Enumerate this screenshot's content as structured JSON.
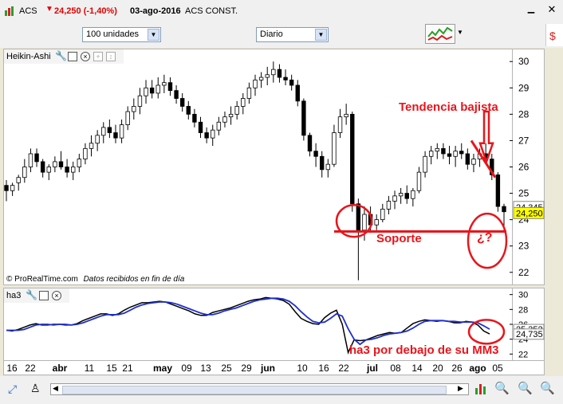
{
  "title": {
    "symbol": "ACS",
    "price": "24,250 (-1,40%)",
    "date": "03-ago-2016",
    "name": "ACS CONST."
  },
  "toolbar": {
    "units": "100 unidades",
    "period": "Diario"
  },
  "price_panel": {
    "indicator_label": "Heikin-Ashi",
    "axis_ticks": [
      "30",
      "29",
      "28",
      "27",
      "26",
      "25",
      "24",
      "23",
      "22"
    ],
    "price_tag_1": "24,345",
    "price_tag_2": "24,250",
    "watermark_brand": "© ProRealTime.com",
    "watermark_note": "Datos recibidos en fin de día",
    "annotations": {
      "trend": "Tendencia bajista",
      "support": "Soporte",
      "question": "¿?"
    }
  },
  "ind_panel": {
    "label": "ha3",
    "axis_ticks": [
      "30",
      "28",
      "26",
      "24",
      "22"
    ],
    "value_1": "25,352",
    "value_2": "24,735",
    "annotation": "ha3 por debajo de su MM3"
  },
  "date_axis": [
    "16",
    "22",
    "abr",
    "11",
    "15",
    "21",
    "may",
    "09",
    "13",
    "25",
    "29",
    "jun",
    "10",
    "16",
    "22",
    "jul",
    "08",
    "14",
    "20",
    "26",
    "ago",
    "05"
  ],
  "colors": {
    "up": "#ffffff",
    "down": "#000000",
    "annotation": "#e8151b",
    "ma": "#1f2fc9",
    "tag_yellow": "#ffff00"
  },
  "chart_data": [
    {
      "type": "candlestick",
      "title": "",
      "ylim": [
        21.6,
        30.4
      ],
      "candles": [
        [
          25.3,
          25.5,
          24.7,
          25.1
        ],
        [
          25.1,
          25.4,
          24.9,
          25.3
        ],
        [
          25.4,
          25.7,
          25.1,
          25.6
        ],
        [
          25.6,
          26.3,
          25.4,
          26.0
        ],
        [
          26.0,
          26.7,
          25.8,
          26.5
        ],
        [
          26.5,
          26.7,
          26.0,
          26.2
        ],
        [
          26.2,
          26.3,
          25.6,
          25.8
        ],
        [
          25.8,
          26.1,
          25.5,
          26.0
        ],
        [
          26.0,
          26.4,
          25.8,
          26.2
        ],
        [
          26.2,
          26.6,
          25.9,
          26.0
        ],
        [
          26.0,
          26.3,
          25.6,
          25.8
        ],
        [
          25.8,
          26.2,
          25.5,
          26.0
        ],
        [
          26.0,
          26.5,
          25.8,
          26.3
        ],
        [
          26.3,
          26.9,
          26.1,
          26.7
        ],
        [
          26.7,
          27.2,
          26.4,
          26.9
        ],
        [
          26.9,
          27.4,
          26.6,
          27.2
        ],
        [
          27.2,
          27.7,
          26.9,
          27.5
        ],
        [
          27.5,
          27.8,
          27.1,
          27.3
        ],
        [
          27.3,
          27.6,
          26.9,
          27.1
        ],
        [
          27.1,
          27.8,
          26.9,
          27.6
        ],
        [
          27.6,
          28.3,
          27.4,
          28.1
        ],
        [
          28.1,
          28.6,
          27.8,
          28.3
        ],
        [
          28.3,
          29.0,
          28.0,
          28.7
        ],
        [
          28.7,
          29.3,
          28.4,
          29.0
        ],
        [
          29.0,
          29.3,
          28.6,
          28.8
        ],
        [
          28.8,
          29.4,
          28.6,
          29.1
        ],
        [
          29.1,
          29.5,
          28.8,
          29.2
        ],
        [
          29.2,
          29.4,
          28.7,
          28.9
        ],
        [
          28.9,
          29.1,
          28.4,
          28.6
        ],
        [
          28.6,
          28.8,
          28.1,
          28.3
        ],
        [
          28.3,
          28.5,
          27.8,
          28.0
        ],
        [
          28.0,
          28.2,
          27.5,
          27.7
        ],
        [
          27.7,
          27.9,
          27.1,
          27.3
        ],
        [
          27.3,
          27.5,
          26.9,
          27.1
        ],
        [
          27.1,
          27.6,
          26.8,
          27.4
        ],
        [
          27.4,
          27.9,
          27.2,
          27.7
        ],
        [
          27.7,
          28.1,
          27.5,
          27.9
        ],
        [
          27.9,
          28.3,
          27.6,
          28.0
        ],
        [
          28.0,
          28.5,
          27.8,
          28.3
        ],
        [
          28.3,
          28.8,
          28.0,
          28.6
        ],
        [
          28.6,
          29.2,
          28.4,
          29.0
        ],
        [
          29.0,
          29.5,
          28.7,
          29.3
        ],
        [
          29.3,
          29.6,
          29.0,
          29.4
        ],
        [
          29.4,
          29.8,
          29.1,
          29.5
        ],
        [
          29.5,
          30.0,
          29.2,
          29.7
        ],
        [
          29.7,
          29.9,
          29.2,
          29.4
        ],
        [
          29.4,
          29.7,
          29.1,
          29.3
        ],
        [
          29.3,
          29.5,
          28.9,
          29.1
        ],
        [
          29.1,
          29.3,
          28.3,
          28.5
        ],
        [
          28.5,
          28.6,
          27.0,
          27.2
        ],
        [
          27.2,
          27.3,
          26.4,
          26.6
        ],
        [
          26.6,
          26.9,
          26.0,
          26.4
        ],
        [
          26.4,
          26.6,
          25.6,
          25.9
        ],
        [
          25.9,
          26.3,
          25.6,
          26.1
        ],
        [
          26.1,
          27.6,
          26.0,
          27.3
        ],
        [
          27.3,
          28.2,
          27.1,
          27.9
        ],
        [
          27.9,
          28.4,
          27.6,
          28.0
        ],
        [
          28.0,
          28.1,
          24.3,
          24.6
        ],
        [
          24.6,
          24.8,
          21.7,
          23.6
        ],
        [
          23.6,
          24.5,
          23.2,
          24.2
        ],
        [
          24.2,
          24.5,
          23.5,
          23.8
        ],
        [
          23.8,
          24.2,
          23.6,
          24.0
        ],
        [
          24.0,
          24.6,
          23.9,
          24.4
        ],
        [
          24.4,
          24.9,
          24.2,
          24.7
        ],
        [
          24.7,
          25.1,
          24.4,
          24.9
        ],
        [
          24.9,
          25.2,
          24.6,
          25.0
        ],
        [
          25.0,
          25.3,
          24.6,
          24.8
        ],
        [
          24.8,
          25.2,
          24.5,
          25.1
        ],
        [
          25.1,
          26.0,
          25.0,
          25.8
        ],
        [
          25.8,
          26.6,
          25.6,
          26.4
        ],
        [
          26.4,
          26.8,
          26.1,
          26.6
        ],
        [
          26.6,
          26.9,
          26.3,
          26.7
        ],
        [
          26.7,
          26.9,
          26.3,
          26.5
        ],
        [
          26.5,
          26.8,
          26.1,
          26.4
        ],
        [
          26.4,
          26.8,
          26.0,
          26.6
        ],
        [
          26.6,
          26.9,
          26.3,
          26.5
        ],
        [
          26.5,
          26.7,
          25.9,
          26.1
        ],
        [
          26.1,
          26.5,
          25.8,
          26.3
        ],
        [
          26.3,
          26.7,
          26.0,
          26.5
        ],
        [
          26.5,
          26.9,
          26.2,
          26.3
        ],
        [
          26.3,
          26.5,
          25.5,
          25.7
        ],
        [
          25.7,
          25.8,
          24.3,
          24.5
        ],
        [
          24.5,
          24.6,
          23.5,
          24.3
        ]
      ]
    },
    {
      "type": "line",
      "title": "",
      "ylim": [
        21.5,
        30.5
      ],
      "series": [
        {
          "values": [
            25.2,
            25.1,
            25.3,
            25.6,
            25.9,
            26.1,
            25.9,
            25.9,
            26.0,
            26.0,
            25.9,
            25.9,
            26.1,
            26.5,
            26.8,
            27.1,
            27.4,
            27.4,
            27.2,
            27.4,
            27.9,
            28.3,
            28.6,
            28.9,
            28.9,
            29.0,
            29.1,
            29.0,
            28.7,
            28.4,
            28.1,
            27.8,
            27.4,
            27.2,
            27.2,
            27.6,
            27.8,
            28.0,
            28.2,
            28.5,
            28.8,
            29.1,
            29.3,
            29.4,
            29.6,
            29.5,
            29.4,
            29.2,
            28.7,
            27.7,
            26.8,
            26.4,
            26.1,
            26.0,
            26.9,
            27.5,
            27.9,
            26.0,
            22.2,
            23.9,
            23.8,
            23.9,
            24.2,
            24.5,
            24.7,
            24.9,
            24.8,
            24.9,
            25.5,
            26.1,
            26.4,
            26.6,
            26.5,
            26.4,
            26.5,
            26.4,
            26.2,
            26.2,
            26.4,
            26.3,
            25.9,
            25.1,
            24.7
          ]
        },
        {
          "name": "MM3",
          "values": [
            25.2,
            25.2,
            25.2,
            25.3,
            25.6,
            25.9,
            26.0,
            26.0,
            25.9,
            26.0,
            26.0,
            25.9,
            26.0,
            26.2,
            26.5,
            26.8,
            27.1,
            27.3,
            27.3,
            27.3,
            27.5,
            27.9,
            28.3,
            28.6,
            28.8,
            28.9,
            29.0,
            29.0,
            28.9,
            28.7,
            28.4,
            28.1,
            27.8,
            27.5,
            27.3,
            27.3,
            27.5,
            27.8,
            28.0,
            28.2,
            28.5,
            28.8,
            29.1,
            29.3,
            29.4,
            29.5,
            29.5,
            29.4,
            29.1,
            28.5,
            27.7,
            27.0,
            26.4,
            26.2,
            26.3,
            26.8,
            27.4,
            27.1,
            25.4,
            24.0,
            23.3,
            23.9,
            24.0,
            24.2,
            24.5,
            24.7,
            24.8,
            24.9,
            25.1,
            25.5,
            26.0,
            26.4,
            26.5,
            26.5,
            26.5,
            26.4,
            26.4,
            26.3,
            26.3,
            26.3,
            26.2,
            25.8,
            25.35
          ]
        }
      ]
    }
  ]
}
